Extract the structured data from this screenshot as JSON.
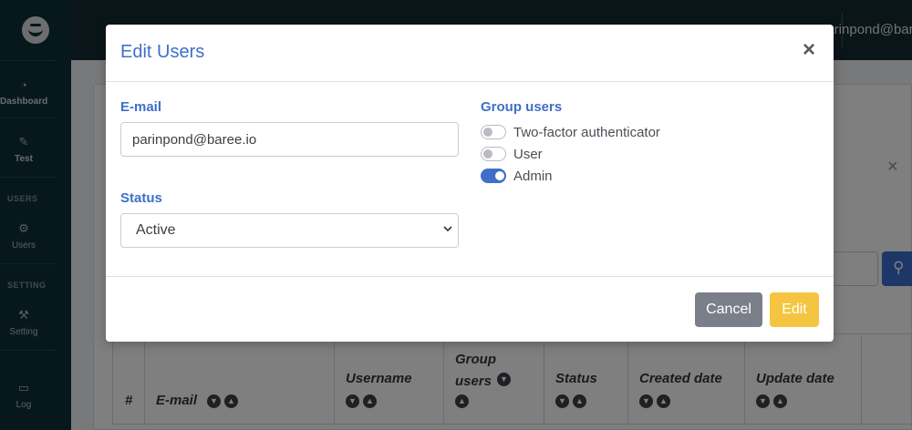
{
  "sidebar": {
    "items": [
      {
        "label": "Dashboard",
        "icon": "gauge-icon"
      },
      {
        "label": "Test",
        "icon": "wrench-icon"
      },
      {
        "label": "Users",
        "icon": "gear-icon"
      },
      {
        "label": "Setting",
        "icon": "wrench-icon"
      },
      {
        "label": "Log",
        "icon": "folder-icon"
      }
    ],
    "sections": {
      "users": "USERS",
      "setting": "SETTING"
    }
  },
  "topbar": {
    "user": "parinpond@baree.io"
  },
  "table": {
    "headers": [
      {
        "label": "#"
      },
      {
        "label": "E-mail"
      },
      {
        "label": "Username"
      },
      {
        "label": "Group users"
      },
      {
        "label": "Status"
      },
      {
        "label": "Created date"
      },
      {
        "label": "Update date"
      }
    ]
  },
  "modal": {
    "title": "Edit Users",
    "close_symbol": "×",
    "email_label": "E-mail",
    "email_value": "parinpond@baree.io",
    "status_label": "Status",
    "status_value": "Active",
    "group_label": "Group users",
    "groups": [
      {
        "label": "Two-factor authenticator",
        "enabled": false
      },
      {
        "label": "User",
        "enabled": false
      },
      {
        "label": "Admin",
        "enabled": true
      }
    ],
    "cancel_label": "Cancel",
    "edit_label": "Edit"
  },
  "colors": {
    "accent": "#3f6fc9",
    "edit_button": "#f5c542",
    "cancel_button": "#7b7f8a",
    "sidebar": "#0f3138",
    "topbar": "#142a35"
  }
}
